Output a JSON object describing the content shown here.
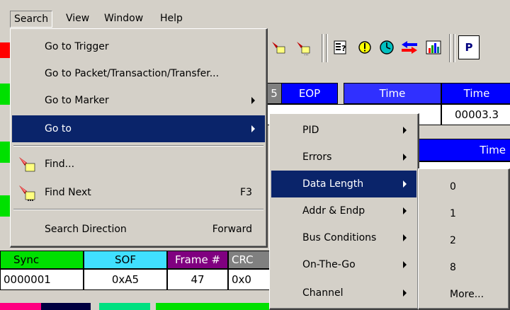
{
  "menubar": {
    "items": [
      {
        "label": "Search"
      },
      {
        "label": "View"
      },
      {
        "label": "Window"
      },
      {
        "label": "Help"
      }
    ]
  },
  "table": {
    "top_headers": {
      "col5": "5",
      "eop": "EOP",
      "time": "Time",
      "time2": "Time"
    },
    "top_values": {
      "time2": "00003.3"
    },
    "mid_headers": {
      "time": "Time"
    },
    "bottom_headers": {
      "sync": "Sync",
      "sof": "SOF",
      "frame": "Frame #",
      "crc": "CRC"
    },
    "bottom_values": {
      "sync": "0000001",
      "sof": "0xA5",
      "frame": "47",
      "crc": "0x0"
    }
  },
  "toolbar": {
    "partial_label": "P"
  },
  "search_menu": {
    "items": [
      {
        "label": "Go to Trigger"
      },
      {
        "label": "Go to Packet/Transaction/Transfer..."
      },
      {
        "label": "Go to Marker"
      },
      {
        "label": "Go to"
      },
      {
        "label": "Find..."
      },
      {
        "label": "Find Next",
        "shortcut": "F3"
      },
      {
        "label": "Search Direction",
        "shortcut": "Forward"
      }
    ]
  },
  "goto_menu": {
    "items": [
      {
        "label": "PID"
      },
      {
        "label": "Errors"
      },
      {
        "label": "Data Length"
      },
      {
        "label": "Addr & Endp"
      },
      {
        "label": "Bus Conditions"
      },
      {
        "label": "On-The-Go"
      },
      {
        "label": "Channel"
      }
    ]
  },
  "data_length_menu": {
    "items": [
      {
        "label": "0"
      },
      {
        "label": "1"
      },
      {
        "label": "2"
      },
      {
        "label": "8"
      },
      {
        "label": "More..."
      }
    ]
  },
  "colors": {
    "menu_highlight": "#0a246a",
    "sync_header": "#00e000",
    "sof_header": "#40e0ff",
    "frame_header": "#800080",
    "crc_header": "#808080",
    "eop_header": "#0000ff",
    "time_header": "#3030ff"
  }
}
